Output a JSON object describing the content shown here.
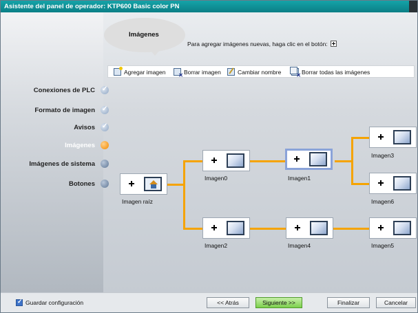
{
  "window": {
    "title": "Asistente del panel de operador: KTP600 Basic color PN"
  },
  "bubble": {
    "title": "Imágenes"
  },
  "hint": {
    "text": "Para agregar imágenes nuevas, haga clic en el botón:"
  },
  "toolbar": {
    "add_image": "Agregar imagen",
    "delete_image": "Borrar imagen",
    "rename": "Cambiar nombre",
    "delete_all": "Borrar todas las imágenes"
  },
  "sidebar": {
    "items": [
      {
        "label": "Conexiones de PLC",
        "state": "done"
      },
      {
        "label": "Formato de imagen",
        "state": "done"
      },
      {
        "label": "Avisos",
        "state": "done"
      },
      {
        "label": "Imágenes",
        "state": "active"
      },
      {
        "label": "Imágenes de sistema",
        "state": "todo"
      },
      {
        "label": "Botones",
        "state": "todo"
      }
    ]
  },
  "tree": {
    "root": "Imagen raíz",
    "nodes": [
      "Imagen0",
      "Imagen1",
      "Imagen2",
      "Imagen3",
      "Imagen4",
      "Imagen5",
      "Imagen6"
    ],
    "selected": "Imagen1"
  },
  "footer": {
    "save_config": "Guardar configuración",
    "save_checked": true,
    "back": "<< Atrás",
    "next": "Siguiente >>",
    "finish": "Finalizar",
    "cancel": "Cancelar"
  },
  "colors": {
    "title_bar": "#0b7f86",
    "connector": "#f5a300",
    "active_step": "#f38a00",
    "next_button": "#7ccf4d"
  }
}
